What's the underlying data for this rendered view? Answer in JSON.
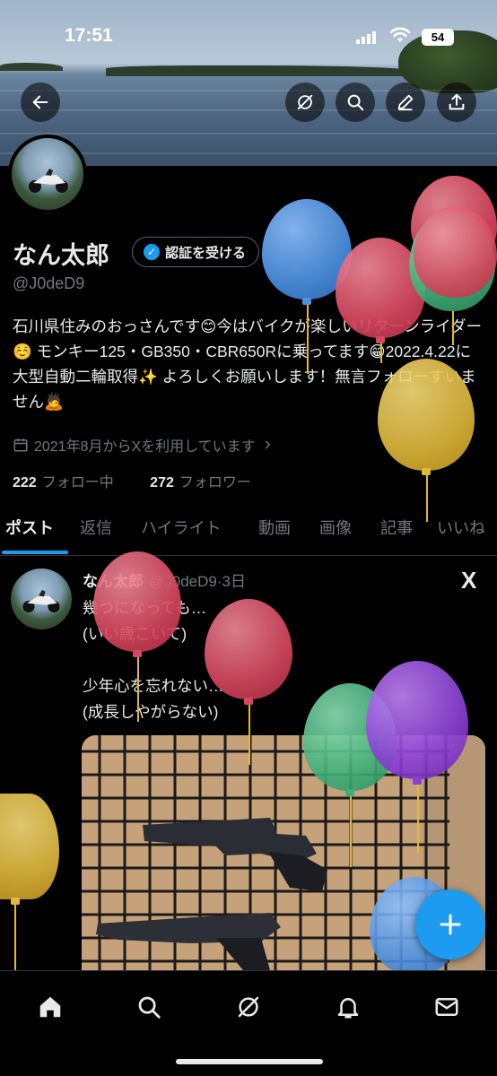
{
  "status_bar": {
    "time": "17:51",
    "battery": "54"
  },
  "header": {
    "back_icon": "arrow-left-icon",
    "action_icons": [
      "grok-icon",
      "search-icon",
      "edit-icon",
      "share-icon"
    ]
  },
  "profile": {
    "name": "なん太郎",
    "verify_label": "認証を受ける",
    "handle": "@J0deD9",
    "bio": "石川県住みのおっさんです😊今はバイクが楽しいリターンライダー☺️ モンキー125・GB350・CBR650Rに乗ってます😁2022.4.22に大型自動二輪取得✨ よろしくお願いします！無言フォローすいません🙇",
    "joined": "2021年8月からXを利用しています",
    "following_count": "222",
    "following_label": "フォロー中",
    "followers_count": "272",
    "followers_label": "フォロワー"
  },
  "tabs": [
    "ポスト",
    "返信",
    "ハイライト",
    "動画",
    "画像",
    "記事",
    "いいね"
  ],
  "active_tab": "ポスト",
  "post": {
    "name": "なん太郎",
    "meta": "@J0deD9·3日",
    "text": "幾つになっても…\n(いい歳こいて)\n\n少年心を忘れない…\n(成長しやがらない)",
    "logo": "X"
  },
  "fab_icon": "plus-icon",
  "bottom_nav": [
    "home-icon",
    "search-icon",
    "grok-icon",
    "bell-icon",
    "mail-icon"
  ],
  "colors": {
    "accent": "#1d9bf0",
    "background": "#000000",
    "muted": "#71767b",
    "text": "#e7e9ea"
  },
  "balloons": [
    {
      "color": "#4a8fe0"
    },
    {
      "color": "#d8475e"
    },
    {
      "color": "#d8475e"
    },
    {
      "color": "#3fb07a"
    },
    {
      "color": "#e0b83a"
    },
    {
      "color": "#d8475e"
    },
    {
      "color": "#d8475e"
    },
    {
      "color": "#3fb07a"
    },
    {
      "color": "#8a3fd6"
    },
    {
      "color": "#e0b83a"
    },
    {
      "color": "#4a8fe0"
    }
  ]
}
